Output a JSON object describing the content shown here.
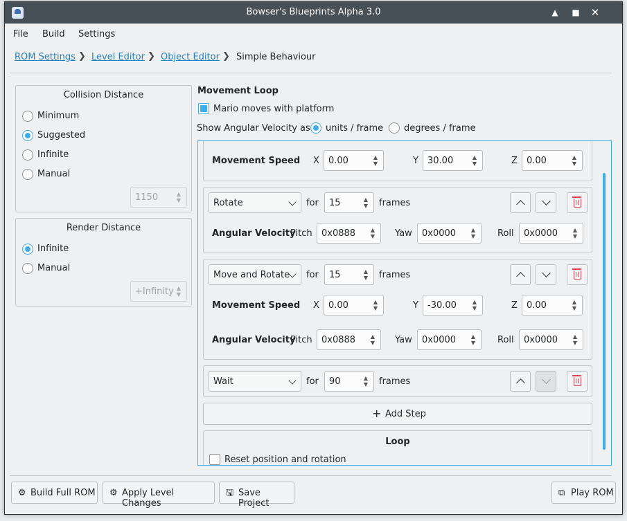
{
  "window": {
    "title": "Bowser's Blueprints Alpha 3.0",
    "icons": [
      "app-icon",
      "minimize-icon",
      "maximize-icon",
      "close-icon"
    ]
  },
  "menu": [
    "File",
    "Build",
    "Settings"
  ],
  "breadcrumb": {
    "items": [
      "ROM Settings",
      "Level Editor",
      "Object Editor"
    ],
    "current": "Simple Behaviour"
  },
  "collision": {
    "title": "Collision Distance",
    "options": [
      "Minimum",
      "Suggested",
      "Infinite",
      "Manual"
    ],
    "selected": "Suggested",
    "value": "1150"
  },
  "render": {
    "title": "Render Distance",
    "options": [
      "Infinite",
      "Manual"
    ],
    "selected": "Infinite",
    "value": "+Infinity"
  },
  "movement": {
    "title": "Movement Loop",
    "mario_checkbox": "Mario moves with platform",
    "mario_checked": true,
    "velocity_label": "Show Angular Velocity as:",
    "velocity_options": [
      "units / frame",
      "degrees / frame"
    ],
    "velocity_selected": "units / frame"
  },
  "labels": {
    "movement_speed": "Movement Speed",
    "angular_velocity": "Angular Velocity",
    "for": "for",
    "frames": "frames",
    "x": "X",
    "y": "Y",
    "z": "Z",
    "pitch": "Pitch",
    "yaw": "Yaw",
    "roll": "Roll"
  },
  "steps": {
    "partial": {
      "x": "0.00",
      "y": "30.00",
      "z": "0.00"
    },
    "rotate": {
      "type": "Rotate",
      "frames": "15",
      "pitch": "0x0888",
      "yaw": "0x0000",
      "roll": "0x0000"
    },
    "move_rotate": {
      "type": "Move and Rotate",
      "frames": "15",
      "x": "0.00",
      "y": "-30.00",
      "z": "0.00",
      "pitch": "0x0888",
      "yaw": "0x0000",
      "roll": "0x0000"
    },
    "wait": {
      "type": "Wait",
      "frames": "90"
    }
  },
  "add_step": "Add Step",
  "loop": {
    "title": "Loop",
    "reset_label": "Reset position and rotation",
    "reset_checked": false
  },
  "footer": {
    "build_full_rom": "Build Full ROM",
    "apply_level": "Apply Level Changes",
    "save_project": "Save Project",
    "play_rom": "Play ROM"
  },
  "colors": {
    "accent": "#3daee9",
    "titlebar": "#475057",
    "danger": "#da4453",
    "link": "#2980b9"
  }
}
